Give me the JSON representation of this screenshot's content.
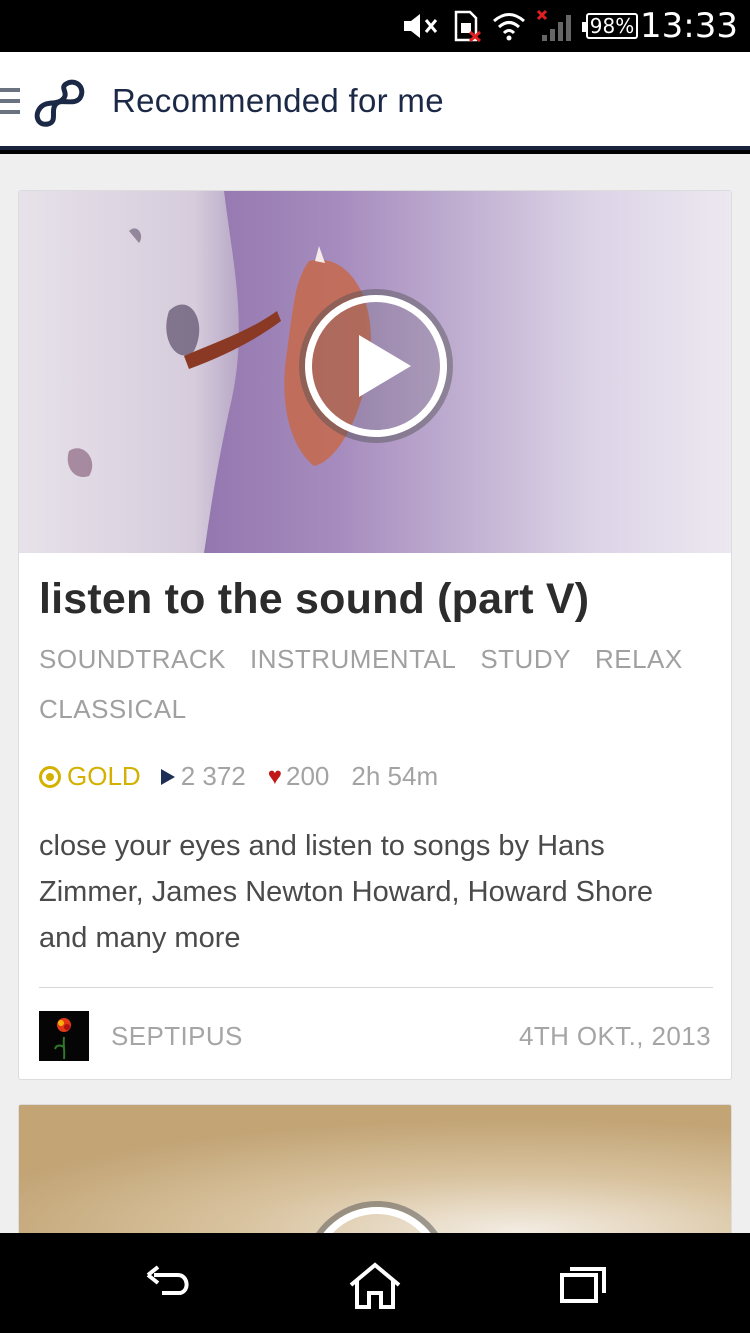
{
  "status_bar": {
    "battery": "98%",
    "time": "13:33",
    "icons": [
      "mute-icon",
      "sim-error-icon",
      "wifi-icon",
      "signal-icon",
      "battery-icon"
    ]
  },
  "app_bar": {
    "title": "Recommended for me",
    "menu_icon": "hamburger-icon",
    "logo_icon": "8tracks-logo-icon"
  },
  "mix": {
    "title": "listen to the sound (part V)",
    "tags": [
      "SOUNDTRACK",
      "INSTRUMENTAL",
      "STUDY",
      "RELAX",
      "CLASSICAL"
    ],
    "badge": "GOLD",
    "plays": "2 372",
    "likes": "200",
    "duration": "2h 54m",
    "description": "close your eyes and listen to songs by Hans Zimmer, James Newton Howard, Howard Shore and many more",
    "author": "SEPTIPUS",
    "date": "4TH OKT., 2013"
  },
  "nav_bar": {
    "buttons": [
      "back-icon",
      "home-icon",
      "recent-apps-icon"
    ]
  },
  "colors": {
    "accent_navy": "#1c2946",
    "gold": "#d4b000",
    "heart_red": "#c01818",
    "background": "#efefef"
  }
}
